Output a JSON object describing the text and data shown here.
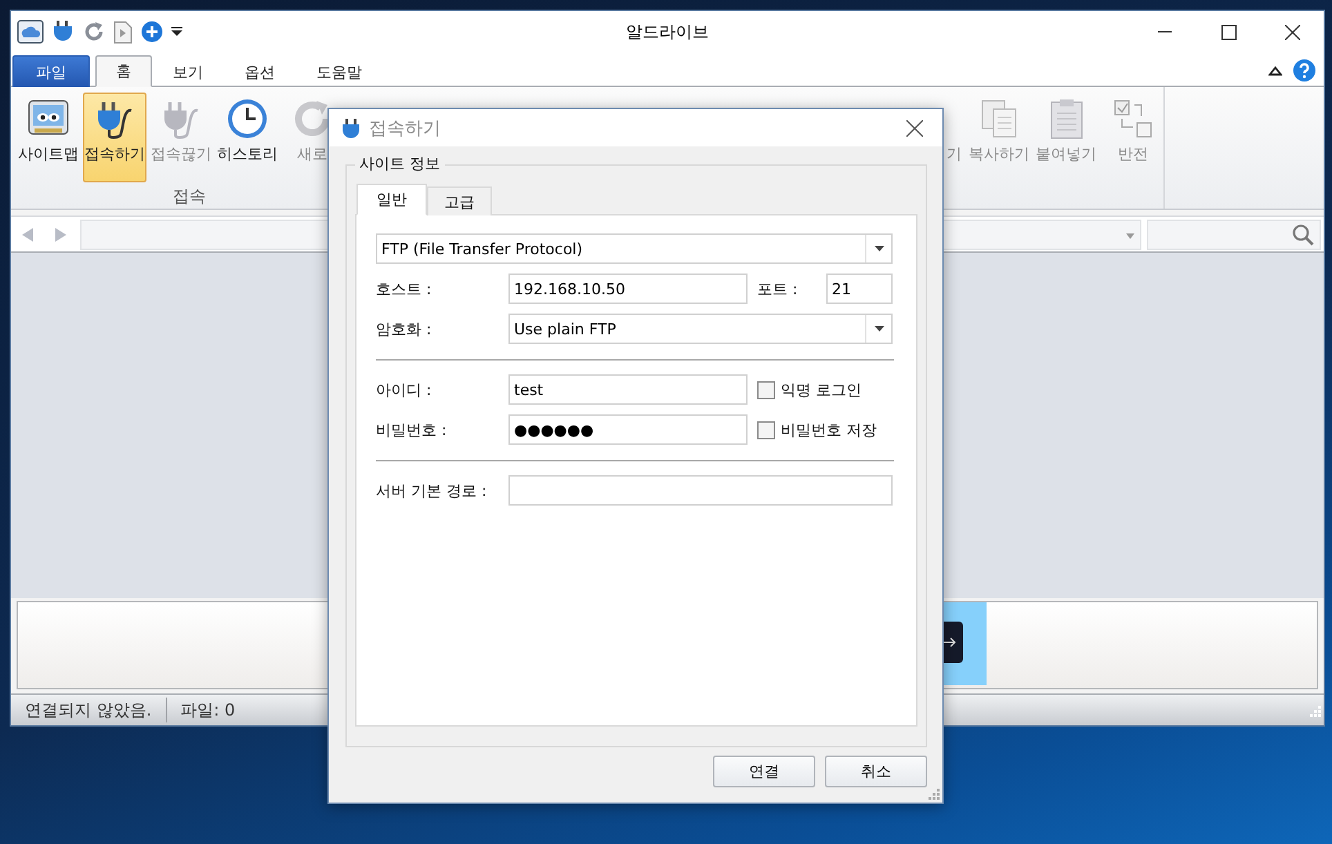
{
  "window": {
    "title": "알드라이브"
  },
  "menu_tabs": [
    {
      "label": "파일",
      "kind": "file",
      "selected": false
    },
    {
      "label": "홈",
      "kind": "tab",
      "selected": true
    },
    {
      "label": "보기",
      "kind": "tab",
      "selected": false
    },
    {
      "label": "옵션",
      "kind": "tab",
      "selected": false
    },
    {
      "label": "도움말",
      "kind": "tab",
      "selected": false
    }
  ],
  "ribbon": {
    "group_label": "접속",
    "left_items": [
      {
        "label": "사이트맵",
        "kind": "sitemap",
        "selected": false,
        "disabled": false
      },
      {
        "label": "접속하기",
        "kind": "connect",
        "selected": true,
        "disabled": false
      },
      {
        "label": "접속끊기",
        "kind": "disconnect",
        "selected": false,
        "disabled": true
      },
      {
        "label": "히스토리",
        "kind": "history",
        "selected": false,
        "disabled": false
      },
      {
        "label": "새로",
        "kind": "refresh",
        "selected": false,
        "disabled": true
      }
    ],
    "right_items": [
      {
        "label": "기",
        "kind": "covered",
        "selected": false,
        "disabled": true
      },
      {
        "label": "복사하기",
        "kind": "copy",
        "selected": false,
        "disabled": true
      },
      {
        "label": "붙여넣기",
        "kind": "paste",
        "selected": false,
        "disabled": true
      },
      {
        "label": "반전",
        "kind": "invert",
        "selected": false,
        "disabled": true
      }
    ]
  },
  "status_bar": [
    "연결되지 않았음.",
    "파일: 0"
  ],
  "dialog": {
    "title": "접속하기",
    "group_title": "사이트 정보",
    "tabs": [
      {
        "label": "일반",
        "selected": true
      },
      {
        "label": "고급",
        "selected": false
      }
    ],
    "protocol": {
      "value": "FTP (File Transfer Protocol)"
    },
    "host": {
      "label": "호스트 :",
      "value": "192.168.10.50"
    },
    "port": {
      "label": "포트 :",
      "value": "21"
    },
    "encryption": {
      "label": "암호화 :",
      "value": "Use plain FTP"
    },
    "user": {
      "label": "아이디 :",
      "value": "test"
    },
    "anonymous": {
      "label": "익명 로그인",
      "checked": false
    },
    "password": {
      "label": "비밀번호 :",
      "value": "●●●●●●"
    },
    "save_password": {
      "label": "비밀번호 저장",
      "checked": false
    },
    "server_path": {
      "label": "서버 기본 경로 :"
    },
    "buttons": [
      "연결",
      "취소"
    ]
  }
}
